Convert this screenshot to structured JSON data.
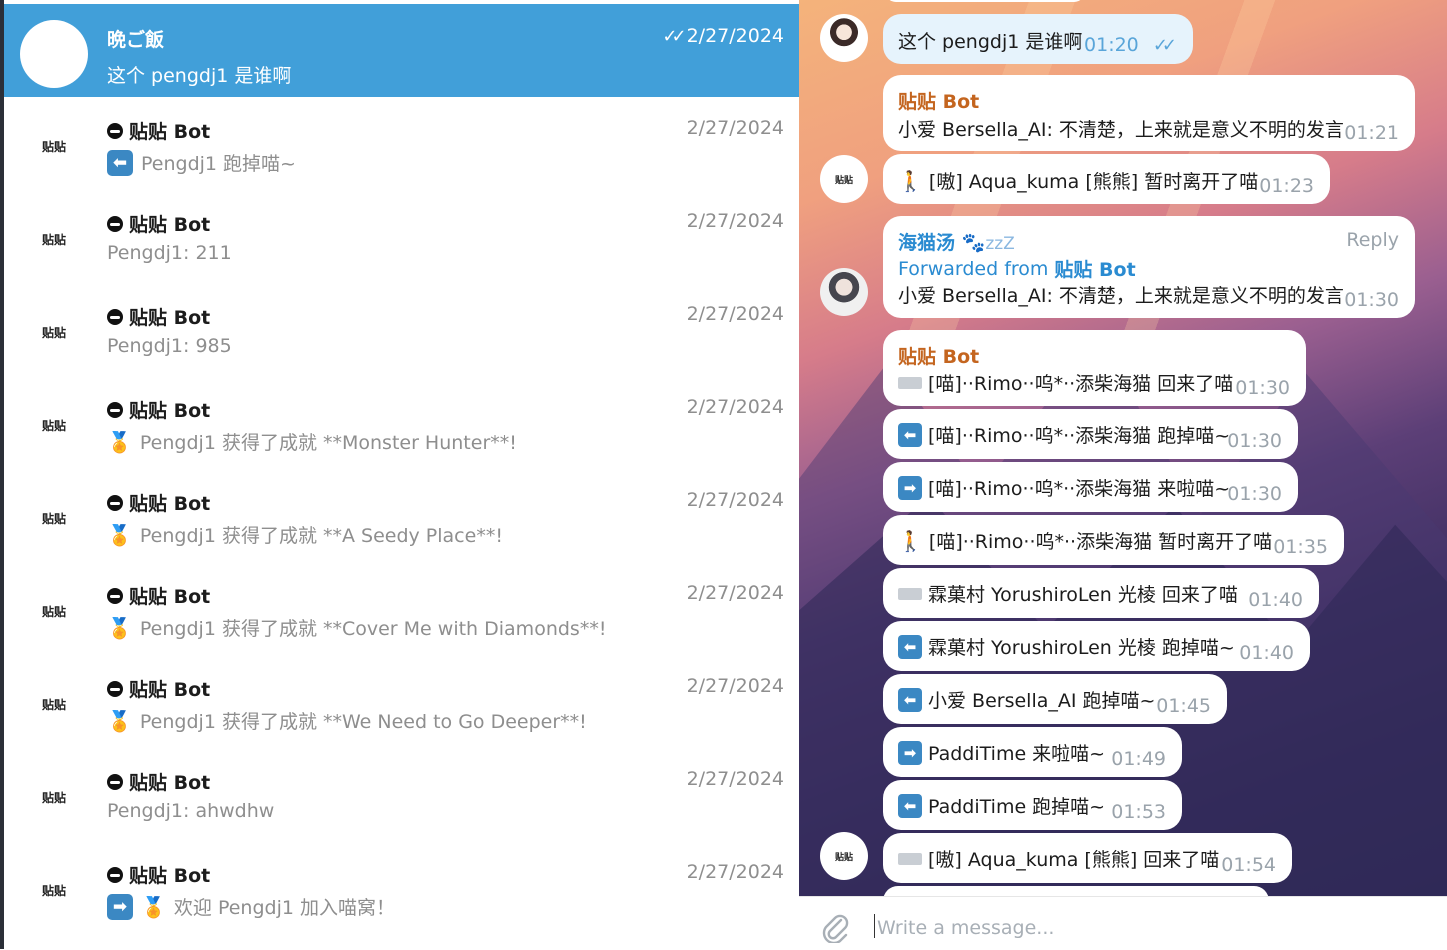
{
  "chat_list": [
    {
      "title": "晩ご飯",
      "date": "2/27/2024",
      "preview": "这个 pengdj1 是谁啊",
      "avatar": "",
      "active": true,
      "read": "✓✓"
    },
    {
      "title": "贴贴 Bot",
      "date": "2/27/2024",
      "preview": "Pengdj1 跑掉喵~",
      "avatar": "贴贴",
      "icon": "⬅"
    },
    {
      "title": "贴贴 Bot",
      "date": "2/27/2024",
      "preview": "Pengdj1: 211",
      "avatar": "贴贴"
    },
    {
      "title": "贴贴 Bot",
      "date": "2/27/2024",
      "preview": "Pengdj1: 985",
      "avatar": "贴贴"
    },
    {
      "title": "贴贴 Bot",
      "date": "2/27/2024",
      "preview": "Pengdj1 获得了成就 **Monster Hunter**!",
      "avatar": "贴贴",
      "icon": "🏅"
    },
    {
      "title": "贴贴 Bot",
      "date": "2/27/2024",
      "preview": "Pengdj1 获得了成就 **A Seedy Place**!",
      "avatar": "贴贴",
      "icon": "🏅"
    },
    {
      "title": "贴贴 Bot",
      "date": "2/27/2024",
      "preview": "Pengdj1 获得了成就 **Cover Me with Diamonds**!",
      "avatar": "贴贴",
      "icon": "🏅"
    },
    {
      "title": "贴贴 Bot",
      "date": "2/27/2024",
      "preview": "Pengdj1 获得了成就 **We Need to Go Deeper**!",
      "avatar": "贴贴",
      "icon": "🏅"
    },
    {
      "title": "贴贴 Bot",
      "date": "2/27/2024",
      "preview": "Pengdj1: ahwdhw",
      "avatar": "贴贴"
    },
    {
      "title": "贴贴 Bot",
      "date": "2/27/2024",
      "preview": "欢迎 Pengdj1 加入喵窝！",
      "avatar": "贴贴",
      "icon": "➡ 🏅"
    }
  ],
  "messages": {
    "m1": {
      "text": "这个 pengdj1 是谁啊",
      "time": "01:20",
      "read": "✓✓"
    },
    "m2": {
      "sender": "贴贴 Bot",
      "text": "小爱 Bersella_AI: 不清楚，上来就是意义不明的发言",
      "time": "01:21"
    },
    "m3": {
      "text": "[嗷] Aqua_kuma [熊熊] 暂时离开了喵",
      "time": "01:23",
      "avatar": "贴贴"
    },
    "m4": {
      "sender": "海猫汤",
      "status": "zzZ",
      "reply": "Reply",
      "fwd_prefix": "Forwarded from",
      "fwd_name": "贴贴 Bot",
      "text": "小爱 Bersella_AI: 不清楚，上来就是意义不明的发言",
      "time": "01:30"
    },
    "m5": {
      "sender": "贴贴 Bot",
      "text": "[喵]··Rimo··呜*··添柴海猫 回来了喵",
      "time": "01:30"
    },
    "m6": {
      "text": "[喵]··Rimo··呜*··添柴海猫 跑掉喵~",
      "time": "01:30"
    },
    "m7": {
      "text": "[喵]··Rimo··呜*··添柴海猫 来啦喵~",
      "time": "01:30"
    },
    "m8": {
      "text": "[喵]··Rimo··呜*··添柴海猫 暂时离开了喵",
      "time": "01:35"
    },
    "m9": {
      "text": "霖菓村 YorushiroLen 光棱 回来了喵",
      "time": "01:40"
    },
    "m10": {
      "text": "霖菓村 YorushiroLen 光棱 跑掉喵~",
      "time": "01:40"
    },
    "m11": {
      "text": "小爱 Bersella_AI 跑掉喵~",
      "time": "01:45"
    },
    "m12": {
      "text": "PaddiTime 来啦喵~",
      "time": "01:49"
    },
    "m13": {
      "text": "PaddiTime 跑掉喵~",
      "time": "01:53"
    },
    "m14": {
      "text": "[嗷] Aqua_kuma [熊熊] 回来了喵",
      "time": "01:54",
      "avatar": "贴贴"
    }
  },
  "composer": {
    "placeholder": "Write a message..."
  },
  "icons": {
    "arrow_left": "⬅",
    "arrow_right": "➡",
    "medal": "🏅",
    "walker": "🚶",
    "paw": "🐾",
    "clip": "📎"
  },
  "colors": {
    "active_row": "#419fd9",
    "bot_sender": "#c4651f",
    "link": "#2a8bd1",
    "outgoing": "#e6f3fc"
  }
}
